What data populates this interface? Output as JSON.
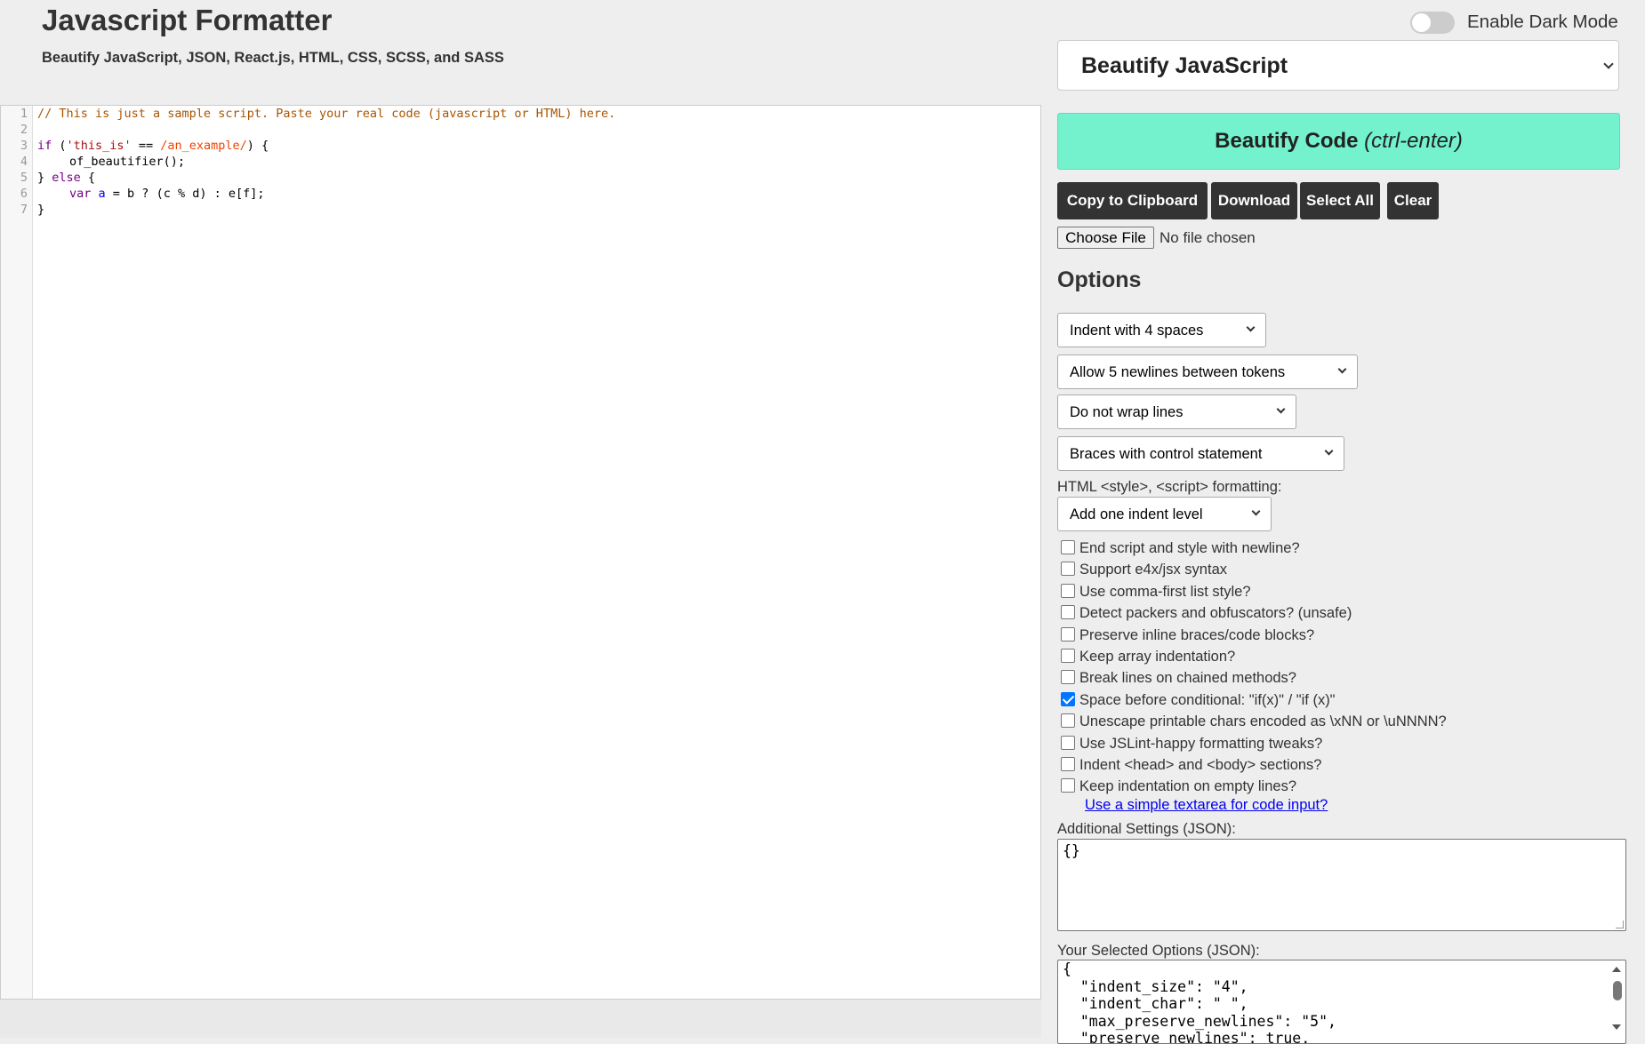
{
  "header": {
    "title": "Javascript Formatter",
    "subtitle": "Beautify JavaScript, JSON, React.js, HTML, CSS, SCSS, and SASS"
  },
  "dark_mode": {
    "label": "Enable Dark Mode",
    "enabled": false
  },
  "mode_select": {
    "value": "Beautify JavaScript"
  },
  "beautify_button": {
    "label": "Beautify Code",
    "shortcut": "(ctrl-enter)"
  },
  "toolbar": {
    "copy_label": "Copy to Clipboard",
    "download_label": "Download",
    "select_all_label": "Select All",
    "clear_label": "Clear"
  },
  "file_input": {
    "button_label": "Choose File",
    "status": "No file chosen"
  },
  "editor": {
    "line_numbers": [
      "1",
      "2",
      "3",
      "4",
      "5",
      "6",
      "7"
    ],
    "line1": "// This is just a sample script. Paste your real code (javascript or HTML) here.",
    "line3": {
      "kw_if": "if",
      "open": " (",
      "str": "'this_is'",
      "op": " == ",
      "re": "/an_example/",
      "close": ") {"
    },
    "line4": "of_beautifier();",
    "line5": {
      "open": "} ",
      "kw_else": "else",
      "close": " {"
    },
    "line6": {
      "kw_var": "var",
      "sp": " ",
      "def": "a",
      "rest": " = b ? (c % d) : e[f];"
    },
    "line7": "}"
  },
  "options": {
    "heading": "Options",
    "indent_select": "Indent with 4 spaces",
    "newlines_select": "Allow 5 newlines between tokens",
    "wrap_select": "Do not wrap lines",
    "braces_select": "Braces with control statement",
    "html_formatting_label": "HTML <style>, <script> formatting:",
    "html_formatting_select": "Add one indent level",
    "checkboxes": [
      {
        "label": "End script and style with newline?",
        "checked": false
      },
      {
        "label": "Support e4x/jsx syntax",
        "checked": false
      },
      {
        "label": "Use comma-first list style?",
        "checked": false
      },
      {
        "label": "Detect packers and obfuscators? (unsafe)",
        "checked": false
      },
      {
        "label": "Preserve inline braces/code blocks?",
        "checked": false
      },
      {
        "label": "Keep array indentation?",
        "checked": false
      },
      {
        "label": "Break lines on chained methods?",
        "checked": false
      },
      {
        "label": "Space before conditional: \"if(x)\" / \"if (x)\"",
        "checked": true
      },
      {
        "label": "Unescape printable chars encoded as \\xNN or \\uNNNN?",
        "checked": false
      },
      {
        "label": "Use JSLint-happy formatting tweaks?",
        "checked": false
      },
      {
        "label": "Indent <head> and <body> sections?",
        "checked": false
      },
      {
        "label": "Keep indentation on empty lines?",
        "checked": false
      }
    ],
    "textarea_link": "Use a simple textarea for code input?",
    "additional_label": "Additional Settings (JSON):",
    "additional_value": "{}",
    "selected_label": "Your Selected Options (JSON):",
    "selected_lines": [
      "{",
      "  \"indent_size\": \"4\",",
      "  \"indent_char\": \" \",",
      "  \"max_preserve_newlines\": \"5\",",
      "  \"preserve_newlines\": true,"
    ]
  }
}
